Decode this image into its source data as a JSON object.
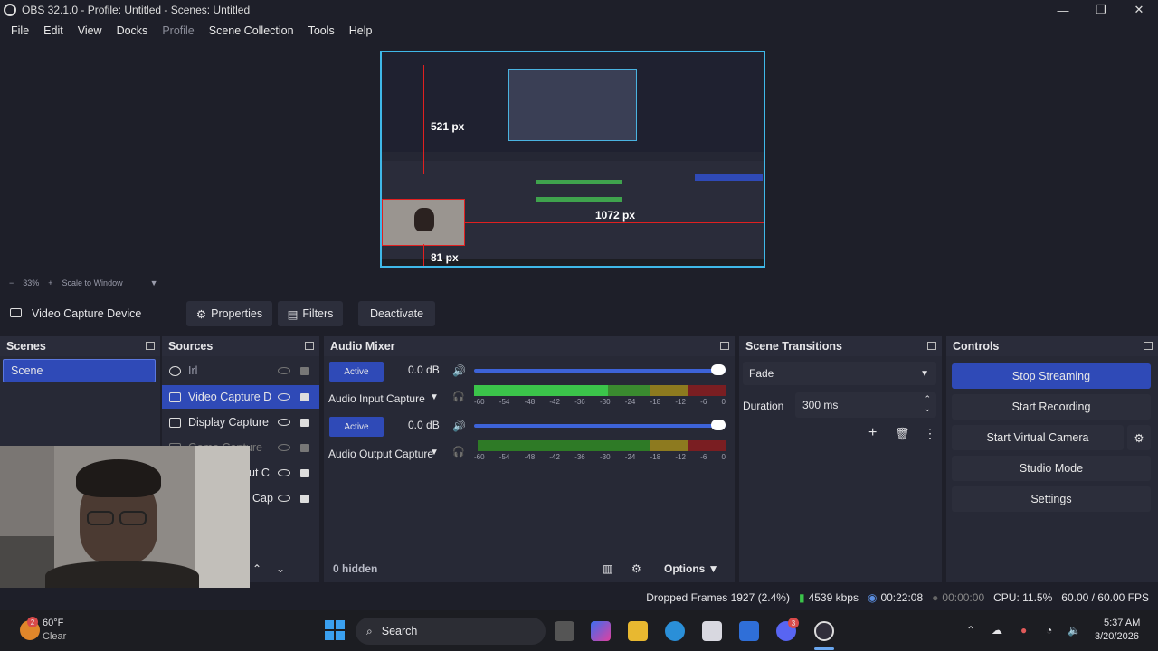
{
  "window": {
    "title": "OBS 32.1.0 - Profile: Untitled - Scenes: Untitled"
  },
  "menu": [
    "File",
    "Edit",
    "View",
    "Docks",
    "Profile",
    "Scene Collection",
    "Tools",
    "Help"
  ],
  "preview": {
    "guide_top": "521 px",
    "guide_right": "1072 px",
    "guide_bottom": "81 px"
  },
  "zoom": {
    "level": "33%",
    "mode": "Scale to Window"
  },
  "source_toolbar": {
    "selected": "Video Capture Device",
    "properties": "Properties",
    "filters": "Filters",
    "deactivate": "Deactivate"
  },
  "scenes": {
    "title": "Scenes",
    "items": [
      "Scene"
    ]
  },
  "sources": {
    "title": "Sources",
    "items": [
      "Irl",
      "Video Capture D",
      "Display Capture",
      "Game Capture",
      "ut C",
      "Cap"
    ]
  },
  "audio": {
    "title": "Audio Mixer",
    "channels": [
      {
        "status": "Active",
        "db": "0.0 dB",
        "name": "Audio Input Capture",
        "level": 0.95
      },
      {
        "status": "Active",
        "db": "0.0 dB",
        "name": "Audio Output Capture",
        "level": 0.95
      }
    ],
    "ticks": [
      "-60",
      "-54",
      "-48",
      "-42",
      "-36",
      "-30",
      "-24",
      "-18",
      "-12",
      "-6",
      "0"
    ],
    "hidden": "0 hidden",
    "options": "Options"
  },
  "transitions": {
    "title": "Scene Transitions",
    "type": "Fade",
    "duration_label": "Duration",
    "duration_value": "300 ms"
  },
  "controls": {
    "title": "Controls",
    "stop_streaming": "Stop Streaming",
    "start_recording": "Start Recording",
    "start_virtual_camera": "Start Virtual Camera",
    "studio_mode": "Studio Mode",
    "settings": "Settings"
  },
  "status": {
    "dropped": "Dropped Frames 1927 (2.4%)",
    "kbps": "4539 kbps",
    "stream_time": "00:22:08",
    "rec_time": "00:00:00",
    "cpu": "CPU: 11.5%",
    "fps": "60.00 / 60.00 FPS"
  },
  "taskbar": {
    "weather_temp": "60°F",
    "weather_desc": "Clear",
    "weather_badge": "2",
    "search": "Search",
    "discord_badge": "3",
    "time": "5:37 AM",
    "date": "3/20/2026"
  },
  "colors": {
    "accent": "#2f4ab7",
    "preview_border": "#3fb8e8",
    "guide": "#e02020"
  }
}
